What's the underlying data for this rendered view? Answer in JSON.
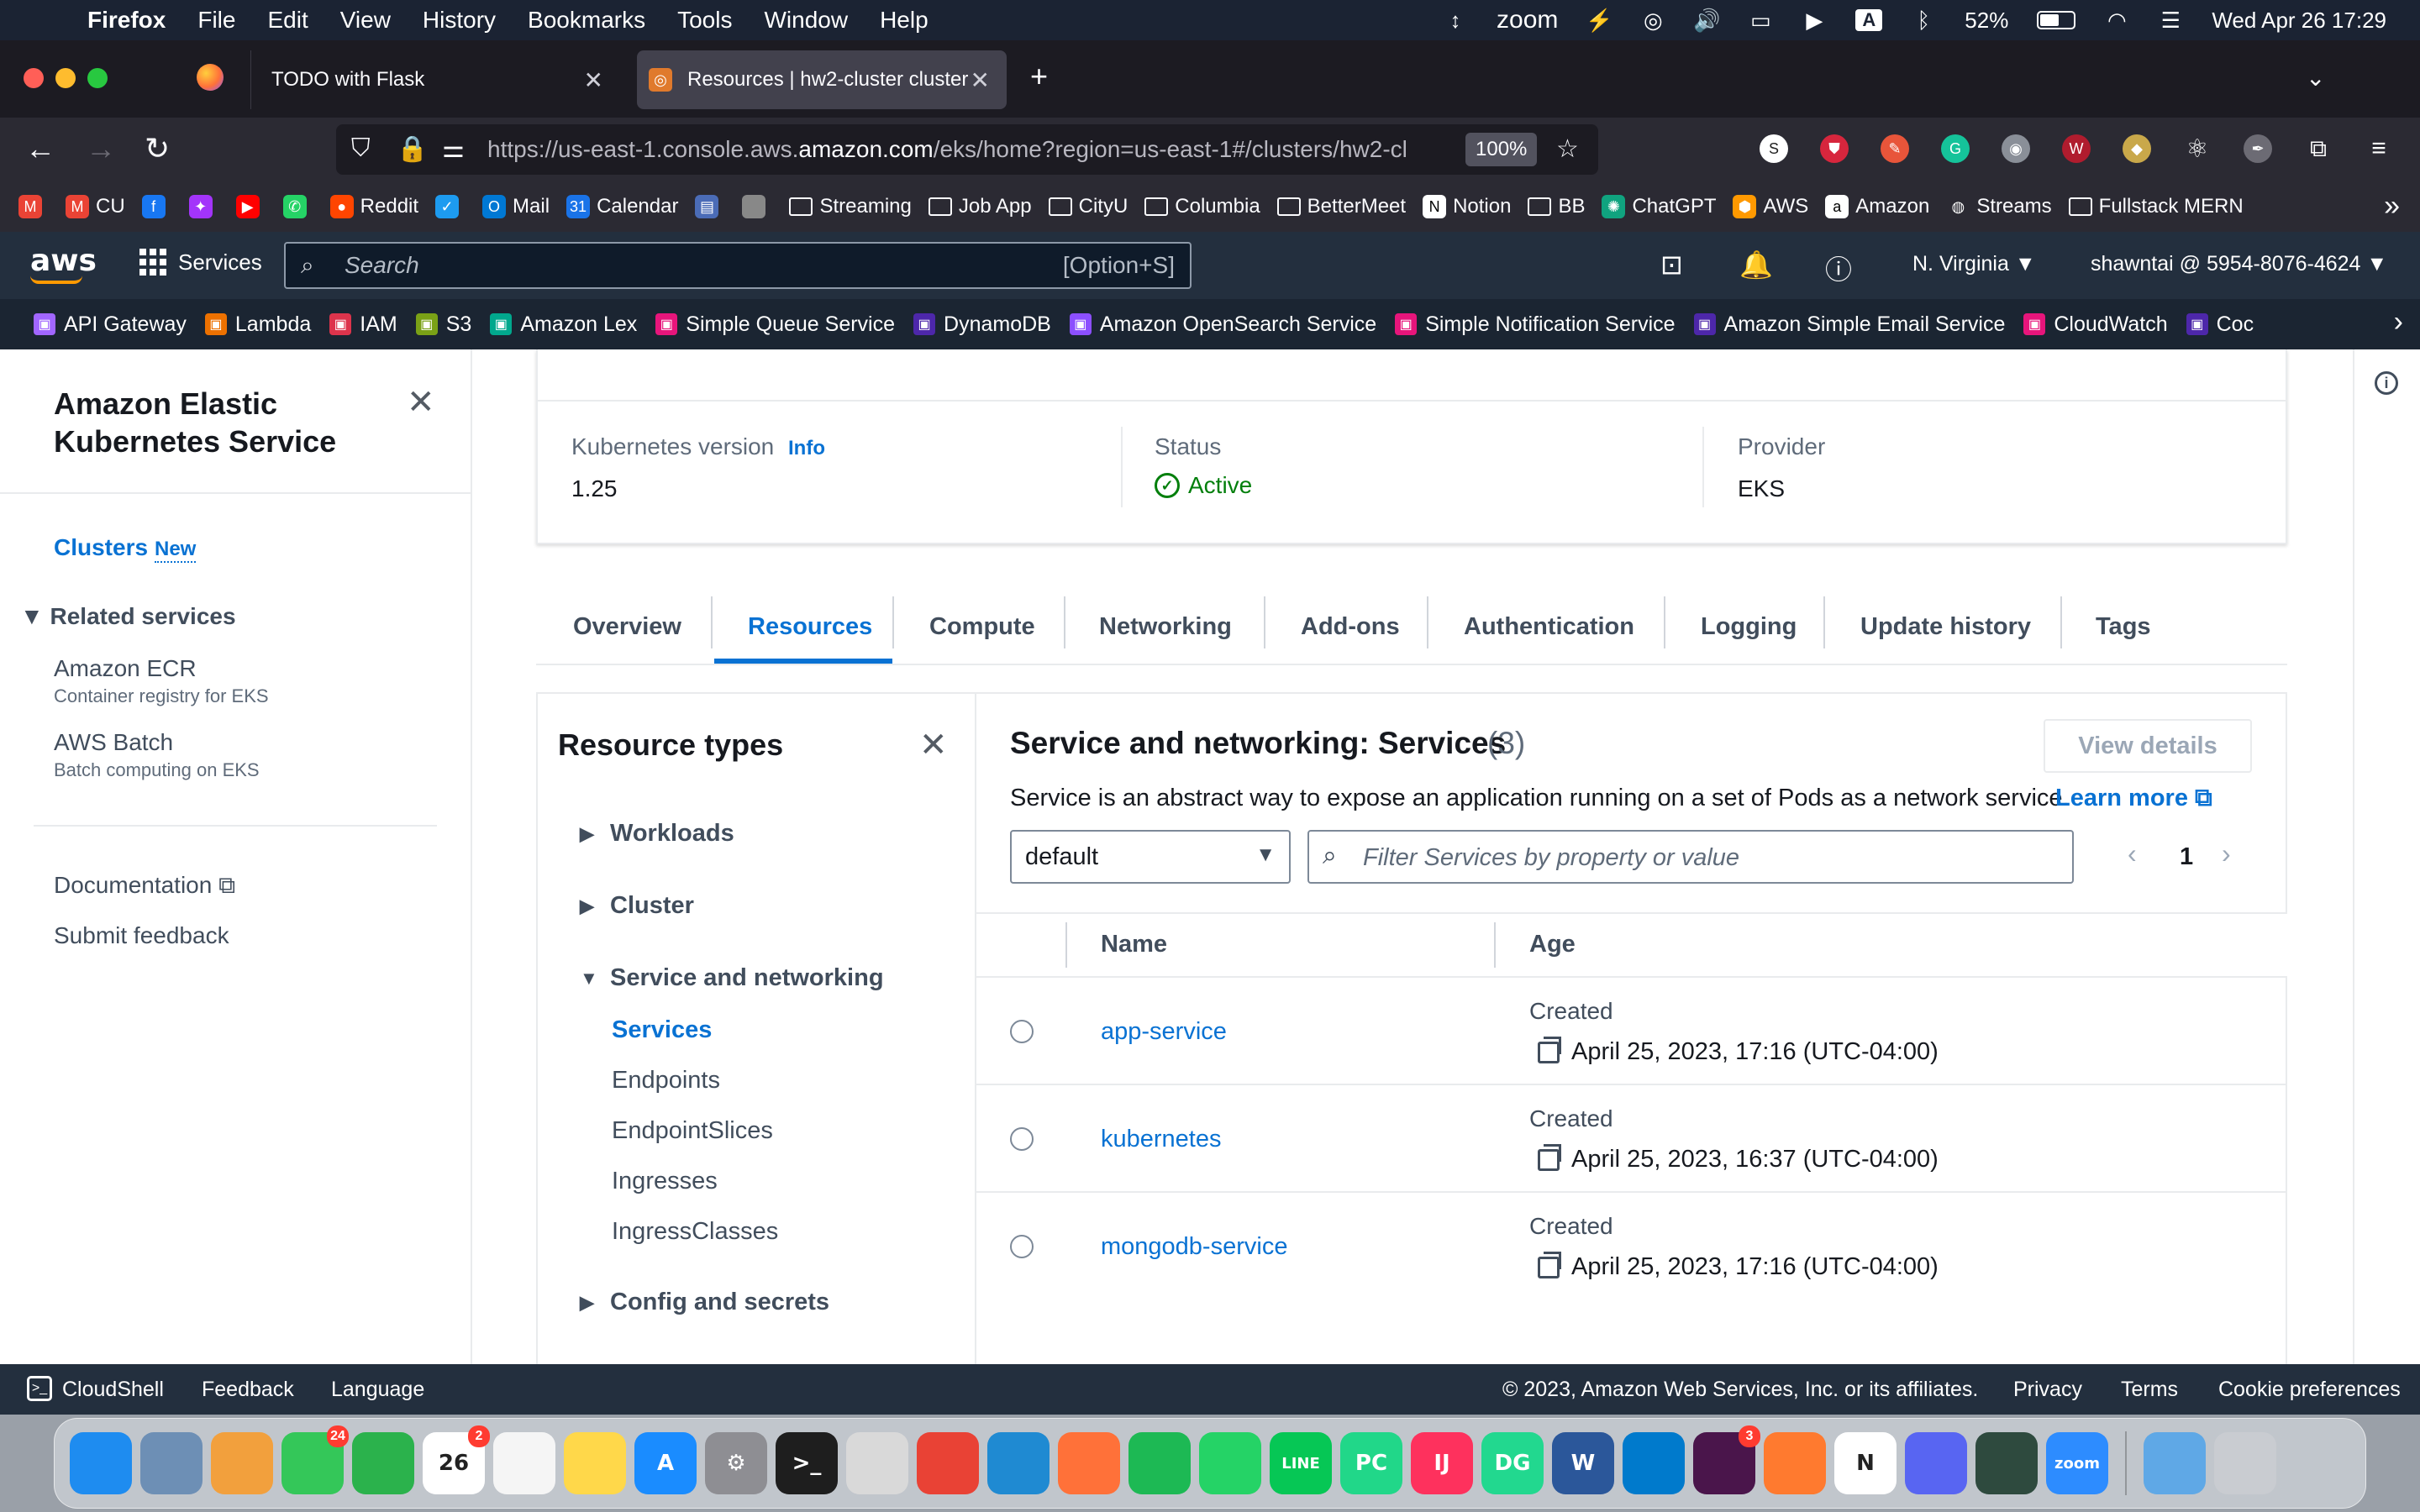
{
  "macos_menubar": {
    "app_name": "Firefox",
    "menus": [
      "File",
      "Edit",
      "View",
      "History",
      "Bookmarks",
      "Tools",
      "Window",
      "Help"
    ],
    "zoom_label": "zoom",
    "input_source": "A",
    "battery": "52%",
    "datetime": "Wed Apr 26  17:29"
  },
  "browser": {
    "tabs": [
      {
        "label": "TODO with Flask",
        "active": false
      },
      {
        "label": "Resources | hw2-cluster cluster",
        "active": true
      }
    ],
    "url_prefix": "https://us-east-1.console.aws.",
    "url_domain": "amazon.com",
    "url_suffix": "/eks/home?region=us-east-1#/clusters/hw2-cl",
    "zoom": "100%",
    "bookmarks": [
      {
        "label": "",
        "icon": "gmail-icon",
        "color": "#ea4335"
      },
      {
        "label": "CU",
        "icon": "gmail-icon",
        "color": "#ea4335"
      },
      {
        "label": "",
        "icon": "facebook-icon",
        "color": "#1877f2"
      },
      {
        "label": "",
        "icon": "messenger-icon",
        "color": "#a334fa"
      },
      {
        "label": "",
        "icon": "youtube-icon",
        "color": "#ff0000"
      },
      {
        "label": "",
        "icon": "whatsapp-icon",
        "color": "#25d366"
      },
      {
        "label": "Reddit",
        "icon": "reddit-icon",
        "color": "#ff4500"
      },
      {
        "label": "",
        "icon": "twitter-icon",
        "color": "#1d9bf0"
      },
      {
        "label": "Mail",
        "icon": "outlook-icon",
        "color": "#0078d4"
      },
      {
        "label": "Calendar",
        "icon": "calendar-icon",
        "color": "#1a73e8"
      },
      {
        "label": "",
        "icon": "tab-icon",
        "color": "#4b6cb7"
      },
      {
        "label": "",
        "icon": "apple-icon",
        "color": "#888888"
      },
      {
        "label": "Streaming",
        "icon": "folder-icon",
        "color": ""
      },
      {
        "label": "Job App",
        "icon": "folder-icon",
        "color": ""
      },
      {
        "label": "CityU",
        "icon": "folder-icon",
        "color": ""
      },
      {
        "label": "Columbia",
        "icon": "folder-icon",
        "color": ""
      },
      {
        "label": "BetterMeet",
        "icon": "folder-icon",
        "color": ""
      },
      {
        "label": "Notion",
        "icon": "notion-icon",
        "color": "#ffffff"
      },
      {
        "label": "BB",
        "icon": "folder-icon",
        "color": ""
      },
      {
        "label": "ChatGPT",
        "icon": "chatgpt-icon",
        "color": "#10a37f"
      },
      {
        "label": "AWS",
        "icon": "aws-icon",
        "color": "#ff9900"
      },
      {
        "label": "Amazon",
        "icon": "amazon-icon",
        "color": "#ffffff"
      },
      {
        "label": "Streams",
        "icon": "globe-icon",
        "color": ""
      },
      {
        "label": "Fullstack MERN",
        "icon": "folder-icon",
        "color": ""
      }
    ]
  },
  "aws_header": {
    "logo": "aws",
    "services_label": "Services",
    "search_placeholder": "Search",
    "search_shortcut": "[Option+S]",
    "region": "N. Virginia ▼",
    "account": "shawntai @ 5954-8076-4624 ▼",
    "favorites": [
      {
        "label": "API Gateway",
        "color": "#a166ff"
      },
      {
        "label": "Lambda",
        "color": "#ed7100"
      },
      {
        "label": "IAM",
        "color": "#dd344c"
      },
      {
        "label": "S3",
        "color": "#7aa116"
      },
      {
        "label": "Amazon Lex",
        "color": "#01a88d"
      },
      {
        "label": "Simple Queue Service",
        "color": "#e7157b"
      },
      {
        "label": "DynamoDB",
        "color": "#4d27aa"
      },
      {
        "label": "Amazon OpenSearch Service",
        "color": "#8c4fff"
      },
      {
        "label": "Simple Notification Service",
        "color": "#e7157b"
      },
      {
        "label": "Amazon Simple Email Service",
        "color": "#4d27aa"
      },
      {
        "label": "CloudWatch",
        "color": "#e7157b"
      },
      {
        "label": "Coc",
        "color": "#4d27aa"
      }
    ]
  },
  "sidenav": {
    "title": "Amazon Elastic Kubernetes Service",
    "clusters": "Clusters",
    "new_badge": "New",
    "related_services": "Related services",
    "items": [
      {
        "label": "Amazon ECR",
        "sub": "Container registry for EKS"
      },
      {
        "label": "AWS Batch",
        "sub": "Batch computing on EKS"
      }
    ],
    "documentation": "Documentation",
    "feedback": "Submit feedback"
  },
  "cluster_info": {
    "k8s_label": "Kubernetes version",
    "info_link": "Info",
    "k8s_value": "1.25",
    "status_label": "Status",
    "status_value": "Active",
    "provider_label": "Provider",
    "provider_value": "EKS"
  },
  "content_tabs": [
    "Overview",
    "Resources",
    "Compute",
    "Networking",
    "Add-ons",
    "Authentication",
    "Logging",
    "Update history",
    "Tags"
  ],
  "resource_types": {
    "title": "Resource types",
    "groups": {
      "workloads": "Workloads",
      "cluster": "Cluster",
      "service_networking": "Service and networking",
      "config": "Config and secrets"
    },
    "items": [
      "Services",
      "Endpoints",
      "EndpointSlices",
      "Ingresses",
      "IngressClasses"
    ]
  },
  "services_panel": {
    "title": "Service and networking: Services",
    "count": "(3)",
    "view_details": "View details",
    "description": "Service is an abstract way to expose an application running on a set of Pods as a network service.",
    "learn_more": "Learn more",
    "namespace": "default",
    "filter_placeholder": "Filter Services by property or value",
    "page": "1",
    "columns": {
      "name": "Name",
      "age": "Age"
    },
    "rows": [
      {
        "name": "app-service",
        "created_label": "Created",
        "created": "April 25, 2023, 17:16 (UTC-04:00)"
      },
      {
        "name": "kubernetes",
        "created_label": "Created",
        "created": "April 25, 2023, 16:37 (UTC-04:00)"
      },
      {
        "name": "mongodb-service",
        "created_label": "Created",
        "created": "April 25, 2023, 17:16 (UTC-04:00)"
      }
    ]
  },
  "footer": {
    "cloudshell": "CloudShell",
    "feedback": "Feedback",
    "language": "Language",
    "copyright": "© 2023, Amazon Web Services, Inc. or its affiliates.",
    "privacy": "Privacy",
    "terms": "Terms",
    "cookies": "Cookie preferences"
  },
  "dock": {
    "apps": [
      {
        "name": "finder",
        "label": "",
        "color": "#1e8cf0",
        "badge": ""
      },
      {
        "name": "preview",
        "label": "",
        "color": "#6d8fb5",
        "badge": ""
      },
      {
        "name": "photos",
        "label": "",
        "color": "#f2a03d",
        "badge": ""
      },
      {
        "name": "messages",
        "label": "",
        "color": "#34c759",
        "badge": "24"
      },
      {
        "name": "facetime",
        "label": "",
        "color": "#2bb24c",
        "badge": ""
      },
      {
        "name": "calendar",
        "label": "26",
        "color": "#ffffff",
        "badge": "2"
      },
      {
        "name": "reminders",
        "label": "",
        "color": "#f5f5f5",
        "badge": ""
      },
      {
        "name": "notes",
        "label": "",
        "color": "#ffd84a",
        "badge": ""
      },
      {
        "name": "app-store",
        "label": "A",
        "color": "#1a8cff",
        "badge": ""
      },
      {
        "name": "system-settings",
        "label": "⚙",
        "color": "#8e8e93",
        "badge": ""
      },
      {
        "name": "terminal",
        "label": ">_",
        "color": "#1e1e1e",
        "badge": ""
      },
      {
        "name": "script-editor",
        "label": "",
        "color": "#d9d9d9",
        "badge": ""
      },
      {
        "name": "chrome",
        "label": "",
        "color": "#e94235",
        "badge": ""
      },
      {
        "name": "edge",
        "label": "",
        "color": "#1f8ad2",
        "badge": ""
      },
      {
        "name": "firefox",
        "label": "",
        "color": "#ff7139",
        "badge": ""
      },
      {
        "name": "spotify",
        "label": "",
        "color": "#1db954",
        "badge": ""
      },
      {
        "name": "whatsapp",
        "label": "",
        "color": "#25d366",
        "badge": ""
      },
      {
        "name": "line",
        "label": "LINE",
        "color": "#06c755",
        "badge": ""
      },
      {
        "name": "pycharm",
        "label": "PC",
        "color": "#21d789",
        "badge": ""
      },
      {
        "name": "intellij",
        "label": "IJ",
        "color": "#fe315d",
        "badge": ""
      },
      {
        "name": "datagrip",
        "label": "DG",
        "color": "#22d88f",
        "badge": ""
      },
      {
        "name": "word",
        "label": "W",
        "color": "#2b579a",
        "badge": ""
      },
      {
        "name": "vscode",
        "label": "",
        "color": "#007acc",
        "badge": ""
      },
      {
        "name": "slack",
        "label": "",
        "color": "#4a154b",
        "badge": "3"
      },
      {
        "name": "pen-app",
        "label": "",
        "color": "#ff7a2f",
        "badge": ""
      },
      {
        "name": "notion",
        "label": "N",
        "color": "#ffffff",
        "badge": ""
      },
      {
        "name": "discord",
        "label": "",
        "color": "#5865f2",
        "badge": ""
      },
      {
        "name": "git-app",
        "label": "",
        "color": "#2e4a3e",
        "badge": ""
      },
      {
        "name": "zoom",
        "label": "zoom",
        "color": "#2d8cff",
        "badge": ""
      },
      {
        "name": "downloads",
        "label": "",
        "color": "#5fa8e6",
        "badge": ""
      },
      {
        "name": "trash",
        "label": "",
        "color": "#c9ccd1",
        "badge": ""
      }
    ]
  }
}
